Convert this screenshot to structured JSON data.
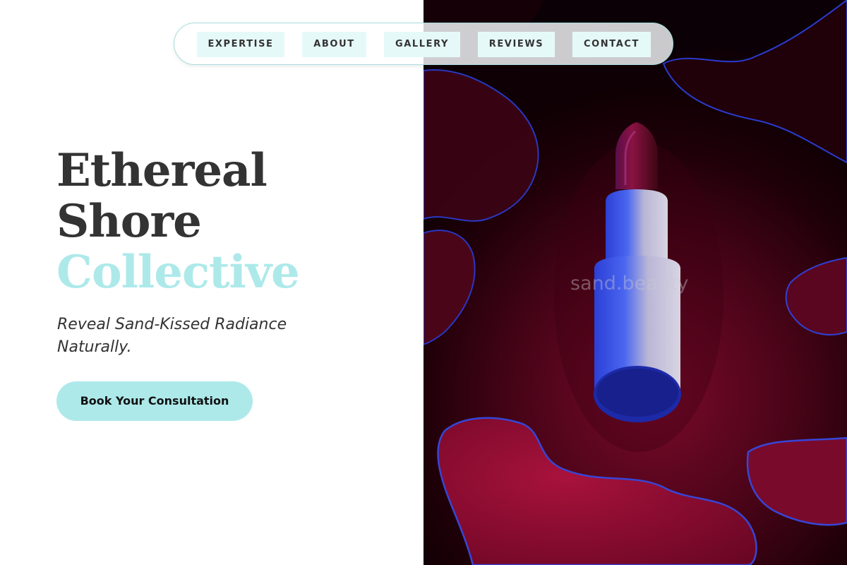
{
  "nav": {
    "items": [
      {
        "label": "EXPERTISE"
      },
      {
        "label": "ABOUT"
      },
      {
        "label": "GALLERY"
      },
      {
        "label": "REVIEWS"
      },
      {
        "label": "CONTACT"
      }
    ]
  },
  "hero": {
    "title_line1": "Ethereal",
    "title_line2": "Shore",
    "title_line3": "Collective",
    "subtitle": "Reveal Sand-Kissed Radiance Naturally.",
    "cta_label": "Book Your Consultation"
  },
  "image": {
    "watermark": "sand.beauty"
  },
  "colors": {
    "accent": "#aee9ea",
    "text": "#333333",
    "nav_item_bg": "#e6f9f9",
    "image_bg": "#4a0418"
  }
}
